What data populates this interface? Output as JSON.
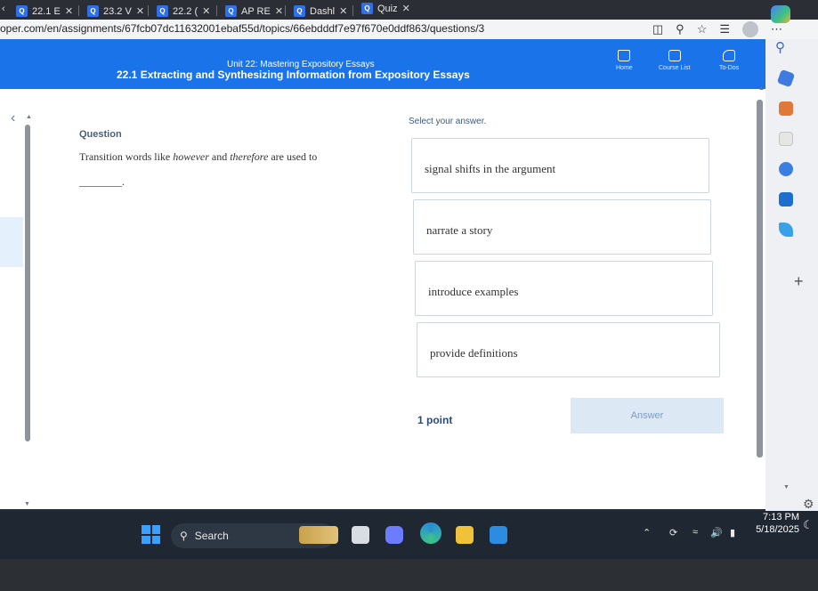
{
  "browser": {
    "tabs": [
      {
        "label": "22.1 E"
      },
      {
        "label": "23.2 V"
      },
      {
        "label": "22.2 ("
      },
      {
        "label": "AP RE"
      },
      {
        "label": "Dashl"
      },
      {
        "label": "Quiz"
      }
    ],
    "url": "oper.com/en/assignments/67fcb07dc11632001ebaf55d/topics/66ebdddf7e97f670e0ddf863/questions/3"
  },
  "header": {
    "unit_title": "Unit 22: Mastering Expository Essays",
    "lesson_title": "22.1 Extracting and Synthesizing Information from Expository Essays",
    "nav": [
      {
        "label": "Home",
        "icon": "home-icon"
      },
      {
        "label": "Course List",
        "icon": "course-list-icon"
      },
      {
        "label": "To-Dos",
        "icon": "todos-icon"
      }
    ]
  },
  "question": {
    "label": "Question",
    "text_before": "Transition words like ",
    "word1": "however",
    "text_mid": " and ",
    "word2": "therefore",
    "text_after": " are used to",
    "blank": "________."
  },
  "answers": {
    "prompt": "Select your answer.",
    "options": [
      {
        "label": "signal shifts in the argument"
      },
      {
        "label": "narrate a story"
      },
      {
        "label": "introduce examples"
      },
      {
        "label": "provide definitions"
      }
    ],
    "points": "1 point",
    "submit_label": "Answer"
  },
  "taskbar": {
    "search_label": "Search",
    "time": "7:13 PM",
    "date": "5/18/2025"
  },
  "colors": {
    "header_blue": "#1a73e8",
    "answer_button_bg": "#dde8f5",
    "taskbar": "#1f2733"
  }
}
